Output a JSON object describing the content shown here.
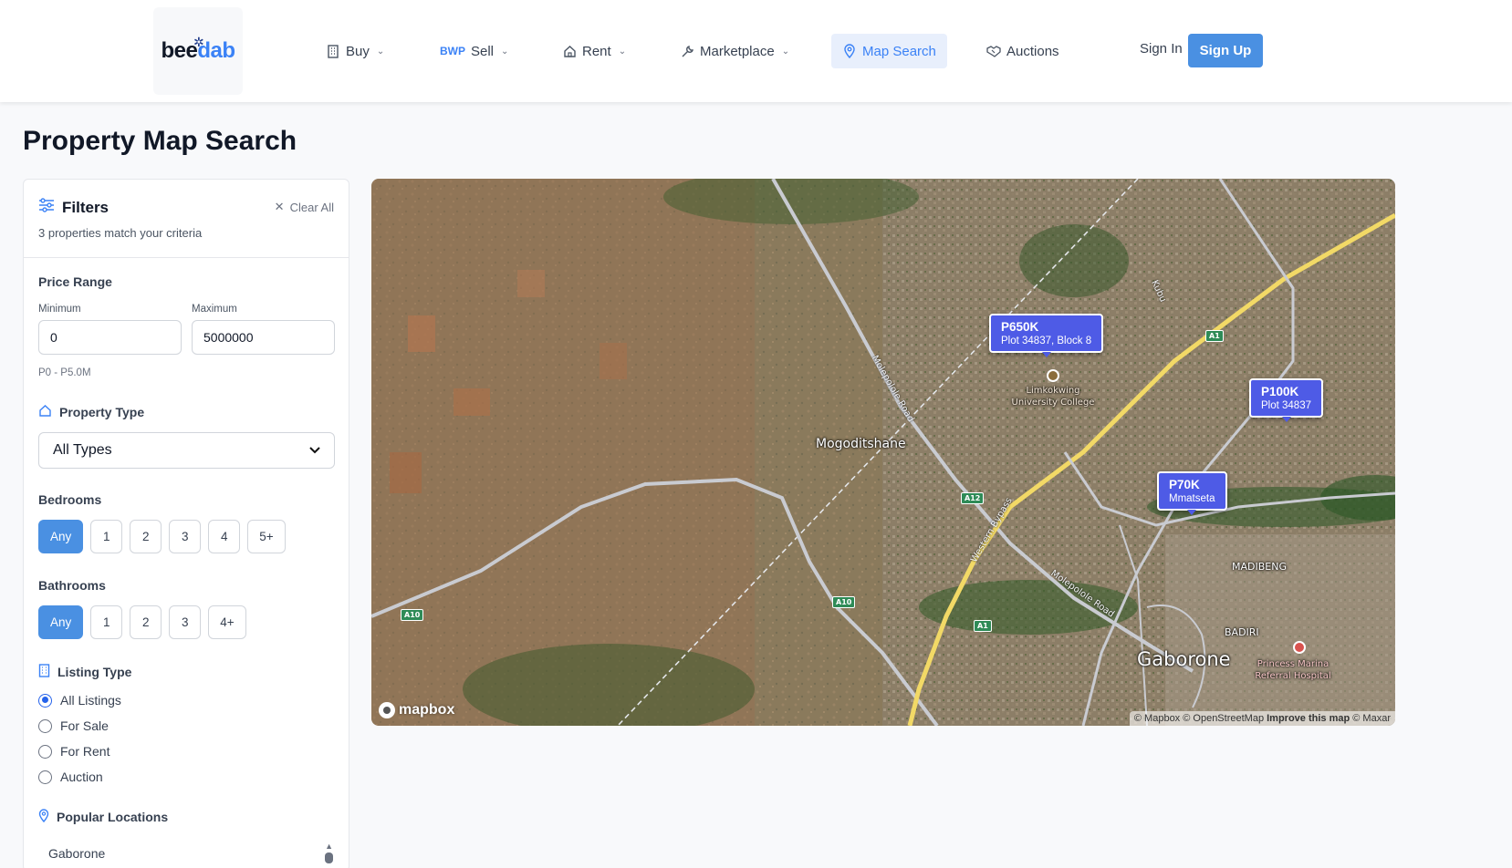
{
  "header": {
    "logo_part1": "bee",
    "logo_part2": "dab",
    "nav": [
      {
        "label": "Buy",
        "icon": "building-icon",
        "has_dropdown": true
      },
      {
        "label": "Sell",
        "prefix": "BWP",
        "icon": "currency-icon",
        "has_dropdown": true
      },
      {
        "label": "Rent",
        "icon": "home-icon",
        "has_dropdown": true
      },
      {
        "label": "Marketplace",
        "icon": "wrench-icon",
        "has_dropdown": true
      },
      {
        "label": "Map Search",
        "icon": "map-pin-icon",
        "active": true
      },
      {
        "label": "Auctions",
        "icon": "handshake-icon"
      }
    ],
    "sign_in": "Sign In",
    "sign_up": "Sign Up"
  },
  "page": {
    "title": "Property Map Search"
  },
  "filters": {
    "title": "Filters",
    "clear_all": "Clear All",
    "match_text": "3 properties match your criteria",
    "price": {
      "title": "Price Range",
      "min_label": "Minimum",
      "max_label": "Maximum",
      "min_value": "0",
      "max_value": "5000000",
      "range_hint": "P0 - P5.0M"
    },
    "property_type": {
      "title": "Property Type",
      "selected": "All Types"
    },
    "bedrooms": {
      "title": "Bedrooms",
      "options": [
        "Any",
        "1",
        "2",
        "3",
        "4",
        "5+"
      ],
      "selected": "Any"
    },
    "bathrooms": {
      "title": "Bathrooms",
      "options": [
        "Any",
        "1",
        "2",
        "3",
        "4+"
      ],
      "selected": "Any"
    },
    "listing_type": {
      "title": "Listing Type",
      "options": [
        "All Listings",
        "For Sale",
        "For Rent",
        "Auction"
      ],
      "selected": "All Listings"
    },
    "popular_locations": {
      "title": "Popular Locations",
      "items": [
        "Gaborone"
      ]
    }
  },
  "map": {
    "markers": [
      {
        "price": "P650K",
        "address": "Plot 34837, Block 8"
      },
      {
        "price": "P100K",
        "address": "Plot 34837"
      },
      {
        "price": "P70K",
        "address": "Mmatseta"
      }
    ],
    "place_labels": {
      "mogoditshane": "Mogoditshane",
      "gaborone": "Gaborone",
      "madibeng": "MADIBENG",
      "badiri": "BADIRI",
      "limkokwing": "Limkokwing University College",
      "hospital": "Princess Marina Referral Hospital"
    },
    "road_labels": {
      "molepolole1": "Molepolole Road",
      "molepolole2": "Molepolole Road",
      "western_bypass": "Western Bypass",
      "kubu": "Kubu"
    },
    "shields": [
      "A1",
      "A1",
      "A12",
      "A10",
      "A10"
    ],
    "logo": "mapbox",
    "attribution_prefix": "© Mapbox © OpenStreetMap",
    "attribution_link": "Improve this map",
    "attribution_suffix": "© Maxar"
  },
  "colors": {
    "accent": "#4a90e2",
    "marker": "#4e5be6",
    "active_nav_bg": "#e8effc"
  }
}
